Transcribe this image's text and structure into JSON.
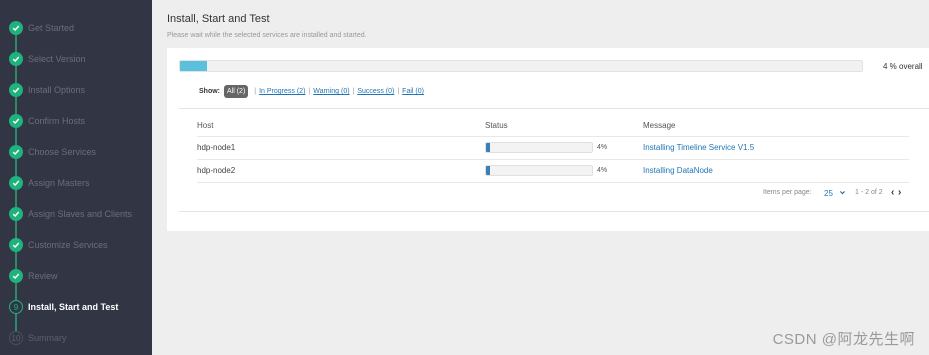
{
  "sidebar": {
    "steps": [
      {
        "label": "Get Started",
        "status": "done"
      },
      {
        "label": "Select Version",
        "status": "done"
      },
      {
        "label": "Install Options",
        "status": "done"
      },
      {
        "label": "Confirm Hosts",
        "status": "done"
      },
      {
        "label": "Choose Services",
        "status": "done"
      },
      {
        "label": "Assign Masters",
        "status": "done"
      },
      {
        "label": "Assign Slaves and Clients",
        "status": "done"
      },
      {
        "label": "Customize Services",
        "status": "done"
      },
      {
        "label": "Review",
        "status": "done"
      },
      {
        "label": "Install, Start and Test",
        "status": "current",
        "number": "9"
      },
      {
        "label": "Summary",
        "status": "pending",
        "number": "10"
      }
    ]
  },
  "main": {
    "title": "Install, Start and Test",
    "subtitle": "Please wait while the selected services are installed and started.",
    "overall_progress": 4,
    "overall_text": "4 % overall"
  },
  "filters": {
    "show_label": "Show:",
    "all": "All (2)",
    "in_progress": "In Progress (2)",
    "warning": "Warning (0)",
    "success": "Success (0)",
    "fail": "Fail (0)",
    "separator": "|"
  },
  "table": {
    "headers": {
      "host": "Host",
      "status": "Status",
      "message": "Message"
    },
    "rows": [
      {
        "host": "hdp-node1",
        "progress": 4,
        "percent_text": "4%",
        "message": "Installing Timeline Service V1.5"
      },
      {
        "host": "hdp-node2",
        "progress": 4,
        "percent_text": "4%",
        "message": "Installing DataNode"
      }
    ]
  },
  "pagination": {
    "items_per_page_label": "Items per page:",
    "items_per_page": "25",
    "range": "1 - 2 of 2",
    "prev_glyph": "‹",
    "next_glyph": "›"
  },
  "watermark": "CSDN @阿龙先生啊",
  "colors": {
    "sidebar_bg": "#323544",
    "done_green": "#1eb27c",
    "overall_bar": "#5bc0de",
    "row_bar": "#3a7fb5",
    "link_blue": "#1f74b5"
  }
}
